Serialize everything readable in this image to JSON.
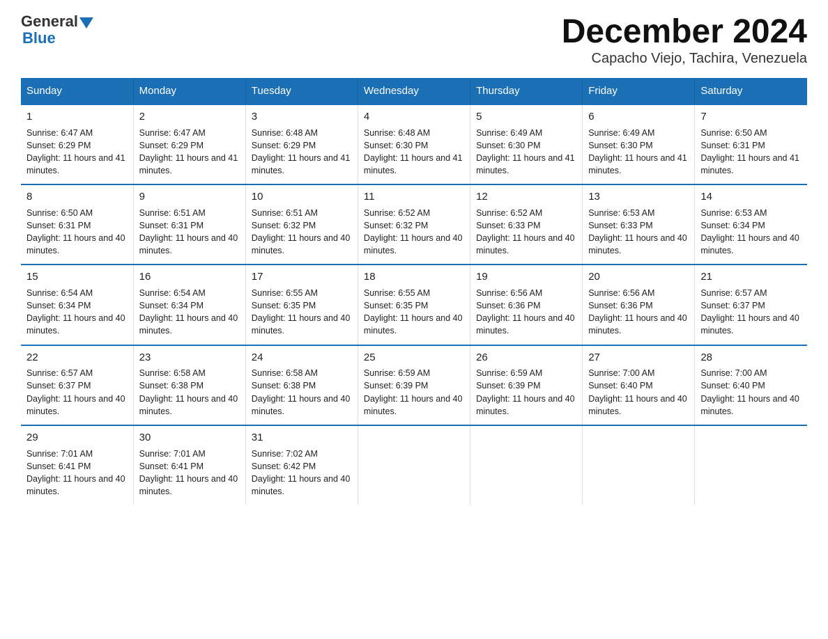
{
  "logo": {
    "general": "General",
    "blue": "Blue"
  },
  "title": "December 2024",
  "subtitle": "Capacho Viejo, Tachira, Venezuela",
  "days_of_week": [
    "Sunday",
    "Monday",
    "Tuesday",
    "Wednesday",
    "Thursday",
    "Friday",
    "Saturday"
  ],
  "weeks": [
    [
      {
        "day": "1",
        "sunrise": "6:47 AM",
        "sunset": "6:29 PM",
        "daylight": "11 hours and 41 minutes."
      },
      {
        "day": "2",
        "sunrise": "6:47 AM",
        "sunset": "6:29 PM",
        "daylight": "11 hours and 41 minutes."
      },
      {
        "day": "3",
        "sunrise": "6:48 AM",
        "sunset": "6:29 PM",
        "daylight": "11 hours and 41 minutes."
      },
      {
        "day": "4",
        "sunrise": "6:48 AM",
        "sunset": "6:30 PM",
        "daylight": "11 hours and 41 minutes."
      },
      {
        "day": "5",
        "sunrise": "6:49 AM",
        "sunset": "6:30 PM",
        "daylight": "11 hours and 41 minutes."
      },
      {
        "day": "6",
        "sunrise": "6:49 AM",
        "sunset": "6:30 PM",
        "daylight": "11 hours and 41 minutes."
      },
      {
        "day": "7",
        "sunrise": "6:50 AM",
        "sunset": "6:31 PM",
        "daylight": "11 hours and 41 minutes."
      }
    ],
    [
      {
        "day": "8",
        "sunrise": "6:50 AM",
        "sunset": "6:31 PM",
        "daylight": "11 hours and 40 minutes."
      },
      {
        "day": "9",
        "sunrise": "6:51 AM",
        "sunset": "6:31 PM",
        "daylight": "11 hours and 40 minutes."
      },
      {
        "day": "10",
        "sunrise": "6:51 AM",
        "sunset": "6:32 PM",
        "daylight": "11 hours and 40 minutes."
      },
      {
        "day": "11",
        "sunrise": "6:52 AM",
        "sunset": "6:32 PM",
        "daylight": "11 hours and 40 minutes."
      },
      {
        "day": "12",
        "sunrise": "6:52 AM",
        "sunset": "6:33 PM",
        "daylight": "11 hours and 40 minutes."
      },
      {
        "day": "13",
        "sunrise": "6:53 AM",
        "sunset": "6:33 PM",
        "daylight": "11 hours and 40 minutes."
      },
      {
        "day": "14",
        "sunrise": "6:53 AM",
        "sunset": "6:34 PM",
        "daylight": "11 hours and 40 minutes."
      }
    ],
    [
      {
        "day": "15",
        "sunrise": "6:54 AM",
        "sunset": "6:34 PM",
        "daylight": "11 hours and 40 minutes."
      },
      {
        "day": "16",
        "sunrise": "6:54 AM",
        "sunset": "6:34 PM",
        "daylight": "11 hours and 40 minutes."
      },
      {
        "day": "17",
        "sunrise": "6:55 AM",
        "sunset": "6:35 PM",
        "daylight": "11 hours and 40 minutes."
      },
      {
        "day": "18",
        "sunrise": "6:55 AM",
        "sunset": "6:35 PM",
        "daylight": "11 hours and 40 minutes."
      },
      {
        "day": "19",
        "sunrise": "6:56 AM",
        "sunset": "6:36 PM",
        "daylight": "11 hours and 40 minutes."
      },
      {
        "day": "20",
        "sunrise": "6:56 AM",
        "sunset": "6:36 PM",
        "daylight": "11 hours and 40 minutes."
      },
      {
        "day": "21",
        "sunrise": "6:57 AM",
        "sunset": "6:37 PM",
        "daylight": "11 hours and 40 minutes."
      }
    ],
    [
      {
        "day": "22",
        "sunrise": "6:57 AM",
        "sunset": "6:37 PM",
        "daylight": "11 hours and 40 minutes."
      },
      {
        "day": "23",
        "sunrise": "6:58 AM",
        "sunset": "6:38 PM",
        "daylight": "11 hours and 40 minutes."
      },
      {
        "day": "24",
        "sunrise": "6:58 AM",
        "sunset": "6:38 PM",
        "daylight": "11 hours and 40 minutes."
      },
      {
        "day": "25",
        "sunrise": "6:59 AM",
        "sunset": "6:39 PM",
        "daylight": "11 hours and 40 minutes."
      },
      {
        "day": "26",
        "sunrise": "6:59 AM",
        "sunset": "6:39 PM",
        "daylight": "11 hours and 40 minutes."
      },
      {
        "day": "27",
        "sunrise": "7:00 AM",
        "sunset": "6:40 PM",
        "daylight": "11 hours and 40 minutes."
      },
      {
        "day": "28",
        "sunrise": "7:00 AM",
        "sunset": "6:40 PM",
        "daylight": "11 hours and 40 minutes."
      }
    ],
    [
      {
        "day": "29",
        "sunrise": "7:01 AM",
        "sunset": "6:41 PM",
        "daylight": "11 hours and 40 minutes."
      },
      {
        "day": "30",
        "sunrise": "7:01 AM",
        "sunset": "6:41 PM",
        "daylight": "11 hours and 40 minutes."
      },
      {
        "day": "31",
        "sunrise": "7:02 AM",
        "sunset": "6:42 PM",
        "daylight": "11 hours and 40 minutes."
      },
      null,
      null,
      null,
      null
    ]
  ]
}
